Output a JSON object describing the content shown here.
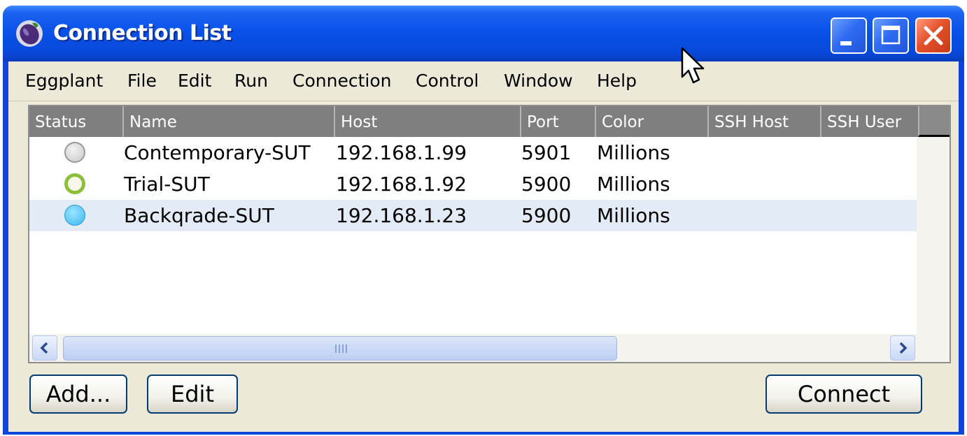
{
  "window": {
    "title": "Connection List",
    "app_icon": "eggplant-icon",
    "controls": [
      "minimize-icon",
      "maximize-icon",
      "close-icon"
    ],
    "colors": {
      "titlebar": "#0a52ea",
      "close": "#e4512d",
      "selected_row": "#e3ebf7",
      "header": "#7f7f7f"
    }
  },
  "menu": {
    "eggplant": "Eggplant",
    "file": "File",
    "edit": "Edit",
    "run": "Run",
    "connection": "Connection",
    "control": "Control",
    "window": "Window",
    "help": "Help"
  },
  "table": {
    "columns": {
      "status": "Status",
      "name": "Name",
      "host": "Host",
      "port": "Port",
      "color": "Color",
      "ssh_host": "SSH Host",
      "ssh_user": "SSH User"
    },
    "rows": [
      {
        "status": "gray",
        "name": "Contemporary-SUT",
        "host": "192.168.1.99",
        "port": "5901",
        "color": "Millions",
        "ssh_host": "",
        "ssh_user": ""
      },
      {
        "status": "green-ring",
        "name": "Trial-SUT",
        "host": "192.168.1.92",
        "port": "5900",
        "color": "Millions",
        "ssh_host": "",
        "ssh_user": ""
      },
      {
        "status": "blue",
        "name": "Backqrade-SUT",
        "host": "192.168.1.23",
        "port": "5900",
        "color": "Millions",
        "ssh_host": "",
        "ssh_user": ""
      }
    ],
    "selected_row": 2
  },
  "buttons": {
    "add": "Add...",
    "edit": "Edit",
    "connect": "Connect"
  }
}
